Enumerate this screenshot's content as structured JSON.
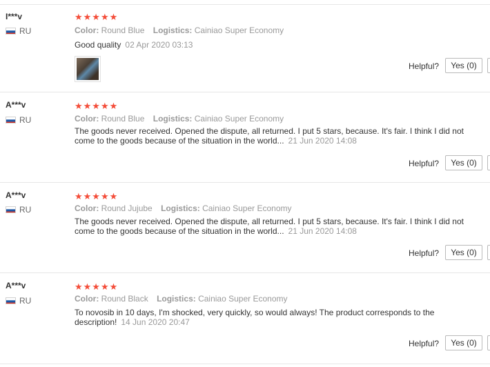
{
  "flag_colors": [
    "#ffffff",
    "#1c57a5",
    "#d52b1e"
  ],
  "star_color": "#f44c38",
  "reviews": [
    {
      "user": "I***v",
      "country": "RU",
      "stars": "★★★★★",
      "rating": 5,
      "color_label": "Color:",
      "color_value": "Round Blue",
      "logistics_label": "Logistics:",
      "logistics_value": "Cainiao Super Economy",
      "text": "Good quality",
      "date": "02 Apr 2020 03:13",
      "helpful_label": "Helpful?",
      "yes_label": "Yes (0)",
      "has_photo": true
    },
    {
      "user": "A***v",
      "country": "RU",
      "stars": "★★★★★",
      "rating": 5,
      "color_label": "Color:",
      "color_value": "Round Blue",
      "logistics_label": "Logistics:",
      "logistics_value": "Cainiao Super Economy",
      "text": "The goods never received. Opened the dispute, all returned. I put 5 stars, because. It's fair. I think I did not come to the goods because of the situation in the world...",
      "date": "21 Jun 2020 14:08",
      "helpful_label": "Helpful?",
      "yes_label": "Yes (0)",
      "has_photo": false
    },
    {
      "user": "A***v",
      "country": "RU",
      "stars": "★★★★★",
      "rating": 5,
      "color_label": "Color:",
      "color_value": "Round Jujube",
      "logistics_label": "Logistics:",
      "logistics_value": "Cainiao Super Economy",
      "text": "The goods never received. Opened the dispute, all returned. I put 5 stars, because. It's fair. I think I did not come to the goods because of the situation in the world...",
      "date": "21 Jun 2020 14:08",
      "helpful_label": "Helpful?",
      "yes_label": "Yes (0)",
      "has_photo": false
    },
    {
      "user": "A***v",
      "country": "RU",
      "stars": "★★★★★",
      "rating": 5,
      "color_label": "Color:",
      "color_value": "Round Black",
      "logistics_label": "Logistics:",
      "logistics_value": "Cainiao Super Economy",
      "text": "To novosib in 10 days, I'm shocked, very quickly, so would always! The product corresponds to the description!",
      "date": "14 Jun 2020 20:47",
      "helpful_label": "Helpful?",
      "yes_label": "Yes (0)",
      "has_photo": false
    }
  ]
}
